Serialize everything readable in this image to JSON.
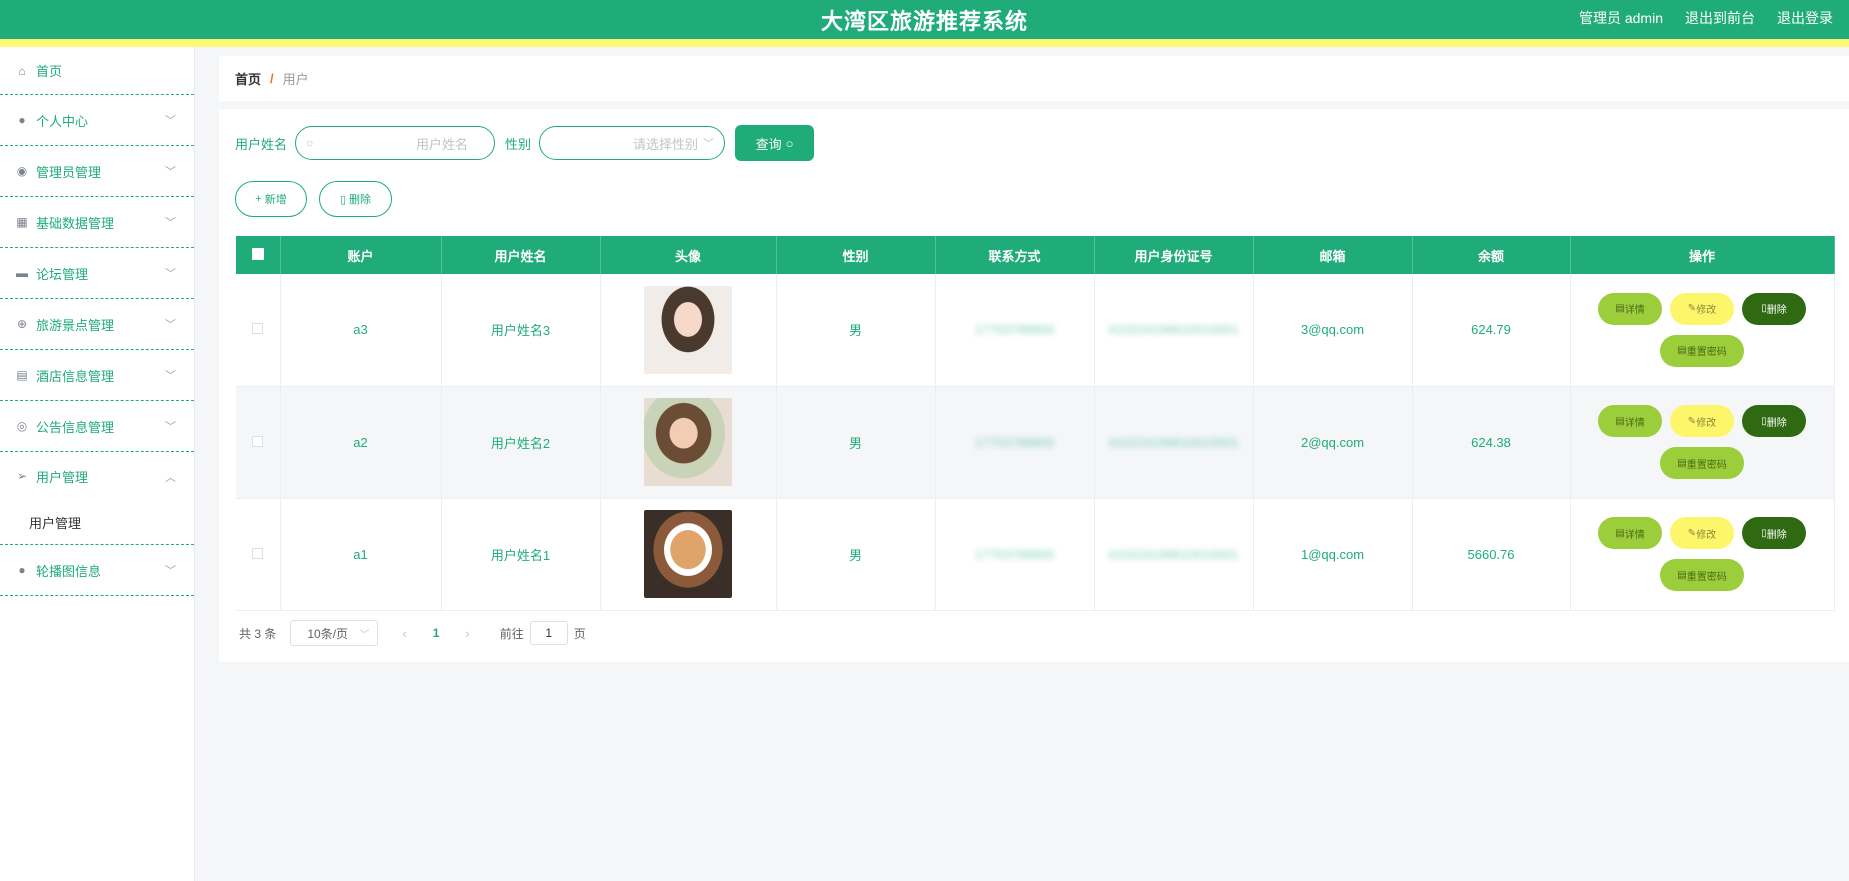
{
  "header": {
    "title": "大湾区旅游推荐系统",
    "admin_label": "管理员 admin",
    "front_label": "退出到前台",
    "logout_label": "退出登录"
  },
  "sidebar": {
    "items": [
      {
        "label": "首页",
        "icon": "home-icon"
      },
      {
        "label": "个人中心",
        "icon": "user-icon"
      },
      {
        "label": "管理员管理",
        "icon": "pin-icon"
      },
      {
        "label": "基础数据管理",
        "icon": "grid-icon"
      },
      {
        "label": "论坛管理",
        "icon": "ticket-icon"
      },
      {
        "label": "旅游景点管理",
        "icon": "globe-icon"
      },
      {
        "label": "酒店信息管理",
        "icon": "briefcase-icon"
      },
      {
        "label": "公告信息管理",
        "icon": "compass-icon"
      },
      {
        "label": "用户管理",
        "icon": "send-icon"
      },
      {
        "label": "轮播图信息",
        "icon": "user-icon"
      }
    ],
    "submenu_label": "用户管理"
  },
  "breadcrumb": {
    "home": "首页",
    "separator": "/",
    "current": "用户"
  },
  "search": {
    "name_label": "用户姓名",
    "name_placeholder": "用户姓名",
    "sex_label": "性别",
    "sex_placeholder": "请选择性别",
    "query_label": "查询"
  },
  "actions": {
    "add_label": "新增",
    "delete_label": "删除"
  },
  "table": {
    "columns": [
      "账户",
      "用户姓名",
      "头像",
      "性别",
      "联系方式",
      "用户身份证号",
      "邮箱",
      "余额",
      "操作"
    ],
    "rows": [
      {
        "account": "a3",
        "name": "用户姓名3",
        "sex": "男",
        "phone": "17703788800",
        "idcard": "410224199610010001",
        "email": "3@qq.com",
        "balance": "624.79"
      },
      {
        "account": "a2",
        "name": "用户姓名2",
        "sex": "男",
        "phone": "17703788800",
        "idcard": "410224199610010001",
        "email": "2@qq.com",
        "balance": "624.38"
      },
      {
        "account": "a1",
        "name": "用户姓名1",
        "sex": "男",
        "phone": "17703788800",
        "idcard": "410224199610010001",
        "email": "1@qq.com",
        "balance": "5660.76"
      }
    ],
    "ops": {
      "detail": "详情",
      "edit": "修改",
      "delete": "删除",
      "reset": "重置密码"
    }
  },
  "pager": {
    "total": "共 3 条",
    "size": "10条/页",
    "page": "1",
    "goto_prefix": "前往",
    "goto_value": "1",
    "goto_suffix": "页"
  },
  "colors": {
    "primary": "#1fac7a",
    "accent": "#fffb78",
    "detail": "#9ccd3a",
    "edit": "#fdf66a",
    "delete": "#2f6a12"
  }
}
